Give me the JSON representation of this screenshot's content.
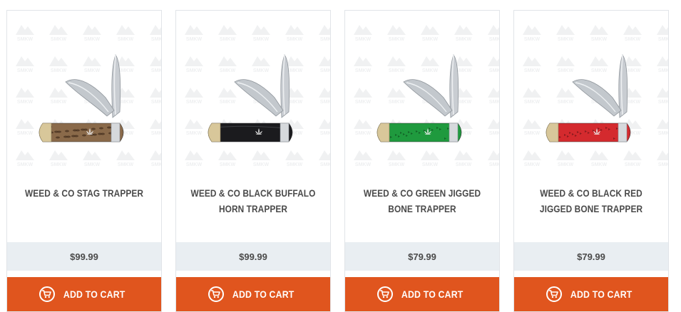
{
  "watermark_text": "SMKW",
  "products": [
    {
      "name": "WEED & CO STAG TRAPPER",
      "price": "$99.99",
      "cart_label": "ADD TO CART",
      "handle_color": "#8a6a4a",
      "handle_style": "stag"
    },
    {
      "name": "WEED & CO BLACK BUFFALO HORN TRAPPER",
      "price": "$99.99",
      "cart_label": "ADD TO CART",
      "handle_color": "#1b1b1e",
      "handle_style": "horn"
    },
    {
      "name": "WEED & CO GREEN JIGGED BONE TRAPPER",
      "price": "$79.99",
      "cart_label": "ADD TO CART",
      "handle_color": "#1f9a3e",
      "handle_style": "jigged"
    },
    {
      "name": "WEED & CO BLACK RED JIGGED BONE TRAPPER",
      "price": "$79.99",
      "cart_label": "ADD TO CART",
      "handle_color": "#d42a2e",
      "handle_style": "jigged"
    }
  ],
  "colors": {
    "accent": "#e0551e",
    "price_bar": "#e9eef2",
    "text": "#4a4a4a"
  },
  "icons": {
    "cart": "shopping-cart-icon",
    "leaf": "cannabis-leaf-icon"
  }
}
